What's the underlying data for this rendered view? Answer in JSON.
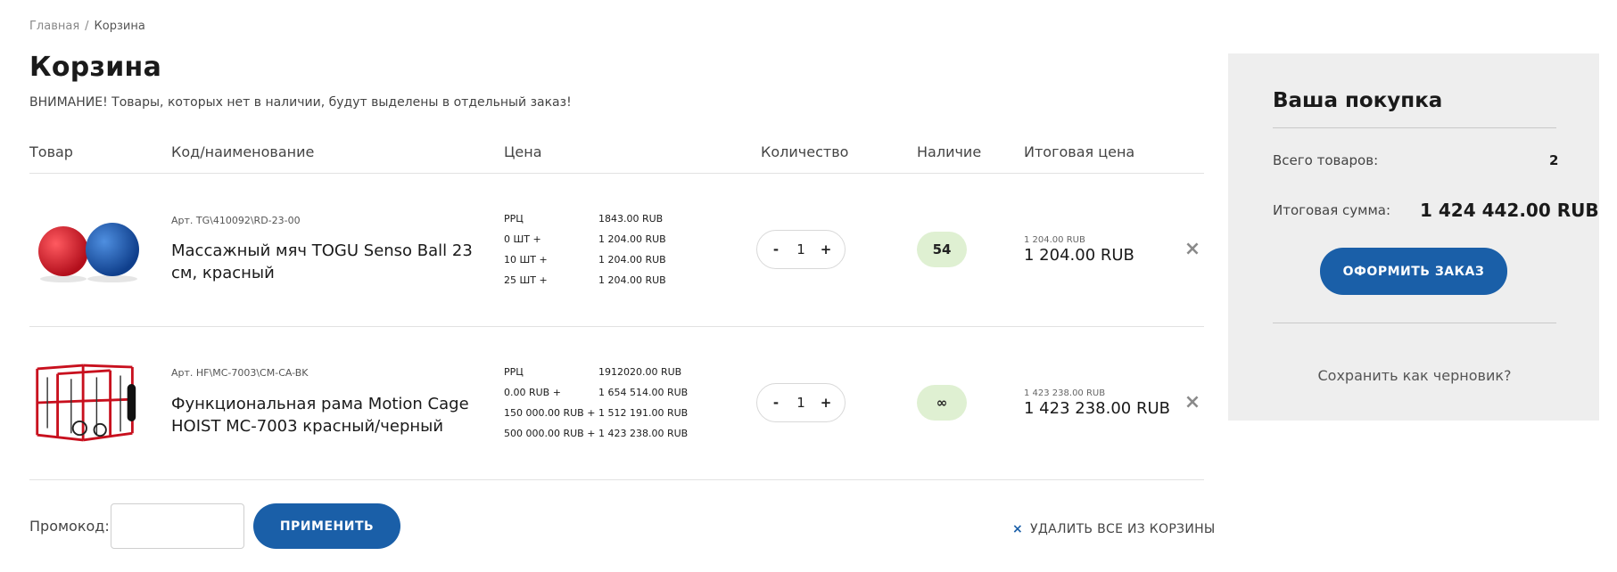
{
  "breadcrumb": {
    "home": "Главная",
    "separator": "/",
    "current": "Корзина"
  },
  "page_title": "Корзина",
  "notice": "ВНИМАНИЕ! Товары, которых нет в наличии, будут выделены в отдельный заказ!",
  "table": {
    "headers": {
      "product": "Товар",
      "code": "Код/наименование",
      "price": "Цена",
      "quantity": "Количество",
      "availability": "Наличие",
      "total": "Итоговая цена"
    },
    "rows": [
      {
        "sku": "Арт. TG\\410092\\RD-23-00",
        "name": "Массажный мяч TOGU Senso Ball 23 см, красный",
        "price_tiers": [
          {
            "label": "РРЦ",
            "value": "1843.00 RUB"
          },
          {
            "label": "0 ШТ +",
            "value": "1 204.00 RUB"
          },
          {
            "label": "10 ШТ +",
            "value": "1 204.00 RUB"
          },
          {
            "label": "25 ШТ +",
            "value": "1 204.00 RUB"
          }
        ],
        "qty_minus": "-",
        "qty": "1",
        "qty_plus": "+",
        "stock": "54",
        "total_small": "1 204.00 RUB",
        "total": "1 204.00 RUB",
        "remove_icon": "close-icon"
      },
      {
        "sku": "Арт. HF\\MC-7003\\CM-CA-BK",
        "name": "Функциональная рама Motion Cage HOIST MC-7003 красный/черный",
        "price_tiers": [
          {
            "label": "РРЦ",
            "value": "1912020.00 RUB"
          },
          {
            "label": "0.00 RUB +",
            "value": "1 654 514.00 RUB"
          },
          {
            "label": "150 000.00 RUB +",
            "value": "1 512 191.00 RUB"
          },
          {
            "label": "500 000.00 RUB +",
            "value": "1 423 238.00 RUB"
          }
        ],
        "qty_minus": "-",
        "qty": "1",
        "qty_plus": "+",
        "stock": "∞",
        "total_small": "1 423 238.00 RUB",
        "total": "1 423 238.00 RUB",
        "remove_icon": "close-icon"
      }
    ]
  },
  "promo": {
    "label": "Промокод:",
    "value": "",
    "apply_label": "ПРИМЕНИТЬ"
  },
  "clear_all": {
    "icon": "×",
    "label": "УДАЛИТЬ ВСЕ ИЗ КОРЗИНЫ"
  },
  "summary": {
    "title": "Ваша покупка",
    "items_label": "Всего товаров:",
    "items_count": "2",
    "total_label": "Итоговая сумма:",
    "total_value": "1 424 442.00 RUB",
    "order_button": "ОФОРМИТЬ ЗАКАЗ",
    "draft_link": "Сохранить как черновик?"
  },
  "colors": {
    "accent": "#1a5fa8",
    "stock_badge": "#dff0d2",
    "summary_bg": "#eeeeee",
    "ball_red": "#d8202b",
    "ball_blue": "#1b5fb8",
    "cage_red": "#c8101e"
  }
}
